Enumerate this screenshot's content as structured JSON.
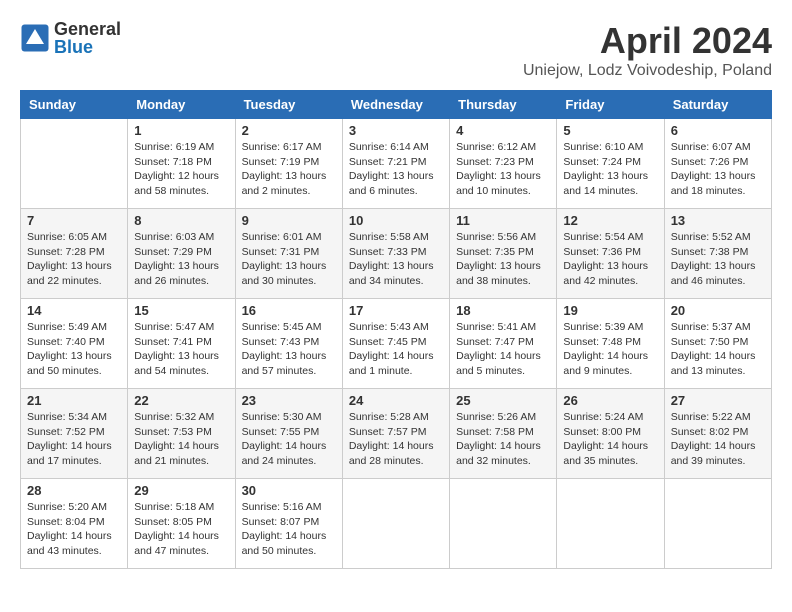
{
  "header": {
    "logo_line1": "General",
    "logo_line2": "Blue",
    "month_title": "April 2024",
    "location": "Uniejow, Lodz Voivodeship, Poland"
  },
  "calendar": {
    "days_of_week": [
      "Sunday",
      "Monday",
      "Tuesday",
      "Wednesday",
      "Thursday",
      "Friday",
      "Saturday"
    ],
    "weeks": [
      [
        {
          "day": "",
          "info": ""
        },
        {
          "day": "1",
          "info": "Sunrise: 6:19 AM\nSunset: 7:18 PM\nDaylight: 12 hours\nand 58 minutes."
        },
        {
          "day": "2",
          "info": "Sunrise: 6:17 AM\nSunset: 7:19 PM\nDaylight: 13 hours\nand 2 minutes."
        },
        {
          "day": "3",
          "info": "Sunrise: 6:14 AM\nSunset: 7:21 PM\nDaylight: 13 hours\nand 6 minutes."
        },
        {
          "day": "4",
          "info": "Sunrise: 6:12 AM\nSunset: 7:23 PM\nDaylight: 13 hours\nand 10 minutes."
        },
        {
          "day": "5",
          "info": "Sunrise: 6:10 AM\nSunset: 7:24 PM\nDaylight: 13 hours\nand 14 minutes."
        },
        {
          "day": "6",
          "info": "Sunrise: 6:07 AM\nSunset: 7:26 PM\nDaylight: 13 hours\nand 18 minutes."
        }
      ],
      [
        {
          "day": "7",
          "info": "Sunrise: 6:05 AM\nSunset: 7:28 PM\nDaylight: 13 hours\nand 22 minutes."
        },
        {
          "day": "8",
          "info": "Sunrise: 6:03 AM\nSunset: 7:29 PM\nDaylight: 13 hours\nand 26 minutes."
        },
        {
          "day": "9",
          "info": "Sunrise: 6:01 AM\nSunset: 7:31 PM\nDaylight: 13 hours\nand 30 minutes."
        },
        {
          "day": "10",
          "info": "Sunrise: 5:58 AM\nSunset: 7:33 PM\nDaylight: 13 hours\nand 34 minutes."
        },
        {
          "day": "11",
          "info": "Sunrise: 5:56 AM\nSunset: 7:35 PM\nDaylight: 13 hours\nand 38 minutes."
        },
        {
          "day": "12",
          "info": "Sunrise: 5:54 AM\nSunset: 7:36 PM\nDaylight: 13 hours\nand 42 minutes."
        },
        {
          "day": "13",
          "info": "Sunrise: 5:52 AM\nSunset: 7:38 PM\nDaylight: 13 hours\nand 46 minutes."
        }
      ],
      [
        {
          "day": "14",
          "info": "Sunrise: 5:49 AM\nSunset: 7:40 PM\nDaylight: 13 hours\nand 50 minutes."
        },
        {
          "day": "15",
          "info": "Sunrise: 5:47 AM\nSunset: 7:41 PM\nDaylight: 13 hours\nand 54 minutes."
        },
        {
          "day": "16",
          "info": "Sunrise: 5:45 AM\nSunset: 7:43 PM\nDaylight: 13 hours\nand 57 minutes."
        },
        {
          "day": "17",
          "info": "Sunrise: 5:43 AM\nSunset: 7:45 PM\nDaylight: 14 hours\nand 1 minute."
        },
        {
          "day": "18",
          "info": "Sunrise: 5:41 AM\nSunset: 7:47 PM\nDaylight: 14 hours\nand 5 minutes."
        },
        {
          "day": "19",
          "info": "Sunrise: 5:39 AM\nSunset: 7:48 PM\nDaylight: 14 hours\nand 9 minutes."
        },
        {
          "day": "20",
          "info": "Sunrise: 5:37 AM\nSunset: 7:50 PM\nDaylight: 14 hours\nand 13 minutes."
        }
      ],
      [
        {
          "day": "21",
          "info": "Sunrise: 5:34 AM\nSunset: 7:52 PM\nDaylight: 14 hours\nand 17 minutes."
        },
        {
          "day": "22",
          "info": "Sunrise: 5:32 AM\nSunset: 7:53 PM\nDaylight: 14 hours\nand 21 minutes."
        },
        {
          "day": "23",
          "info": "Sunrise: 5:30 AM\nSunset: 7:55 PM\nDaylight: 14 hours\nand 24 minutes."
        },
        {
          "day": "24",
          "info": "Sunrise: 5:28 AM\nSunset: 7:57 PM\nDaylight: 14 hours\nand 28 minutes."
        },
        {
          "day": "25",
          "info": "Sunrise: 5:26 AM\nSunset: 7:58 PM\nDaylight: 14 hours\nand 32 minutes."
        },
        {
          "day": "26",
          "info": "Sunrise: 5:24 AM\nSunset: 8:00 PM\nDaylight: 14 hours\nand 35 minutes."
        },
        {
          "day": "27",
          "info": "Sunrise: 5:22 AM\nSunset: 8:02 PM\nDaylight: 14 hours\nand 39 minutes."
        }
      ],
      [
        {
          "day": "28",
          "info": "Sunrise: 5:20 AM\nSunset: 8:04 PM\nDaylight: 14 hours\nand 43 minutes."
        },
        {
          "day": "29",
          "info": "Sunrise: 5:18 AM\nSunset: 8:05 PM\nDaylight: 14 hours\nand 47 minutes."
        },
        {
          "day": "30",
          "info": "Sunrise: 5:16 AM\nSunset: 8:07 PM\nDaylight: 14 hours\nand 50 minutes."
        },
        {
          "day": "",
          "info": ""
        },
        {
          "day": "",
          "info": ""
        },
        {
          "day": "",
          "info": ""
        },
        {
          "day": "",
          "info": ""
        }
      ]
    ]
  }
}
